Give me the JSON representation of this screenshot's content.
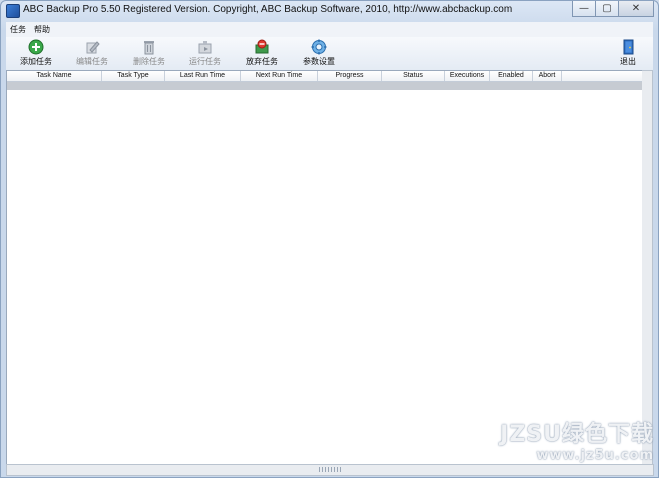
{
  "window": {
    "title": "ABC Backup Pro 5.50   Registered Version.  Copyright,  ABC Backup Software, 2010,   http://www.abcbackup.com",
    "controls": {
      "minimize": "—",
      "maximize": "▢",
      "close": "✕"
    }
  },
  "menu": {
    "items": [
      "任务",
      "帮助"
    ]
  },
  "toolbar": {
    "add_task": "添加任务",
    "edit_task": "编辑任务",
    "delete_task": "删除任务",
    "run_task": "运行任务",
    "abort_task": "放弃任务",
    "settings": "参数设置",
    "exit": "退出"
  },
  "table": {
    "columns": [
      "Task Name",
      "Task Type",
      "Last Run Time",
      "Next Run Time",
      "Progress",
      "Status",
      "Executions",
      "Enabled",
      "Abort"
    ]
  },
  "watermark": {
    "main": "JZSU绿色下载",
    "sub": "www.jz5u.com"
  }
}
